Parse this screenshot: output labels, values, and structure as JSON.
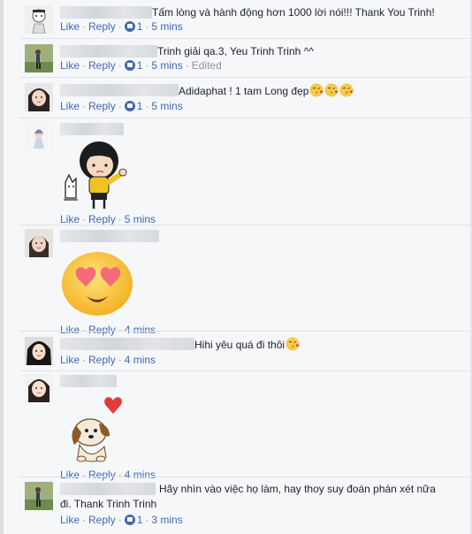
{
  "actions": {
    "like": "Like",
    "reply": "Reply",
    "edited": "Edited"
  },
  "comments": [
    {
      "text": "Tấm lòng và hành động hơn 1000 lời nói!!! Thank You Trinh!",
      "likes": "1",
      "time": "5 mins"
    },
    {
      "text": "Trinh giải qa.3, Yeu Trinh Trinh ^^",
      "likes": "1",
      "time": "5 mins"
    },
    {
      "text": "Adidaphat ! 1 tam Long đẹp",
      "likes": "1",
      "time": "5 mins"
    },
    {
      "text": "",
      "time": "5 mins"
    },
    {
      "text": "",
      "time": "4 mins"
    },
    {
      "text": "Hihi yêu quá đi thôi",
      "time": "4 mins"
    },
    {
      "text": "",
      "time": "4 mins"
    },
    {
      "text": "Hãy nhìn vào việc họ làm, hay thoy suy đoán phán xét nữa đi. Thank Trinh Trinh",
      "likes": "1",
      "time": "3 mins"
    }
  ],
  "colors": {
    "link": "#4267b2",
    "meta": "#90949c",
    "text": "#1d2129",
    "background": "#f6f7f9"
  },
  "icons": [
    "like-reaction-icon",
    "kiss-emoji-icon",
    "heart-eyes-emoji-icon",
    "girl-sticker",
    "puppy-heart-sticker"
  ]
}
